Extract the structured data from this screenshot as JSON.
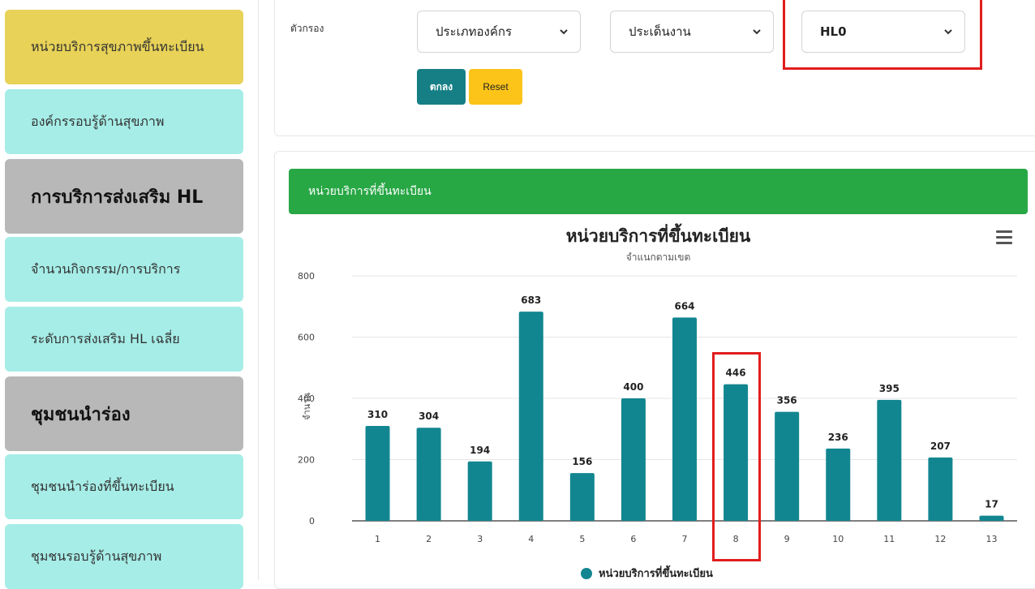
{
  "sidebar": {
    "items": [
      {
        "label": "หน่วยบริการสุขภาพขึ้นทะเบียน"
      },
      {
        "label": "องค์กรรอบรู้ด้านสุขภาพ"
      },
      {
        "label": "การบริการส่งเสริม HL"
      },
      {
        "label": "จำนวนกิจกรรม/การบริการ"
      },
      {
        "label": "ระดับการส่งเสริม HL เฉลี่ย"
      },
      {
        "label": "ชุมชนนำร่อง"
      },
      {
        "label": "ชุมชนนำร่องที่ขึ้นทะเบียน"
      },
      {
        "label": "ชุมชนรอบรู้ด้านสุขภาพ"
      }
    ]
  },
  "filter": {
    "label": "ตัวกรอง",
    "org_type": "ประเภทองค์กร",
    "work_issue": "ประเด็นงาน",
    "level": "HL0",
    "ok_label": "ตกลง",
    "reset_label": "Reset"
  },
  "card": {
    "header": "หน่วยบริการที่ขึ้นทะเบียน"
  },
  "chart_data": {
    "type": "bar",
    "title": "หน่วยบริการที่ขึ้นทะเบียน",
    "subtitle": "จำแนกตามเขต",
    "ylabel": "จำนวน",
    "xlabel": "",
    "ylim": [
      0,
      800
    ],
    "yticks": [
      0,
      200,
      400,
      600,
      800
    ],
    "categories": [
      "1",
      "2",
      "3",
      "4",
      "5",
      "6",
      "7",
      "8",
      "9",
      "10",
      "11",
      "12",
      "13"
    ],
    "series": [
      {
        "name": "หน่วยบริการที่ขึ้นทะเบียน",
        "values": [
          310,
          304,
          194,
          683,
          156,
          400,
          664,
          446,
          356,
          236,
          395,
          207,
          17
        ]
      }
    ],
    "grid": true,
    "legend": "bottom-center",
    "bar_color": "#128690"
  },
  "colors": {
    "accent": "#167f86",
    "header_green": "#28a745",
    "reset_yellow": "#fcc419",
    "highlight_red": "#e11d1d"
  }
}
